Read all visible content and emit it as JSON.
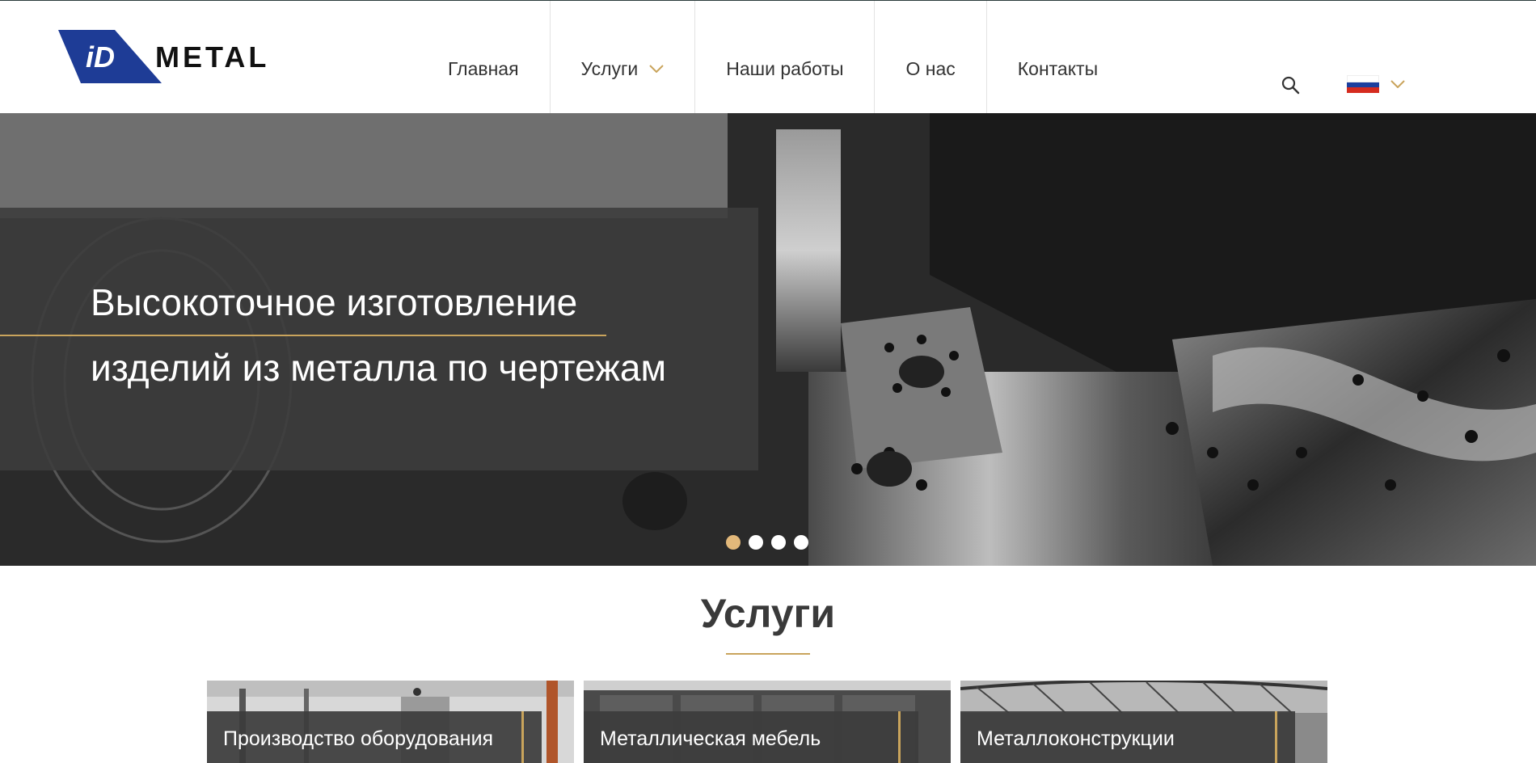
{
  "header": {
    "logo_text": "iDMETAL",
    "nav": [
      {
        "label": "Главная"
      },
      {
        "label": "Услуги",
        "has_dropdown": true
      },
      {
        "label": "Наши работы"
      },
      {
        "label": "О нас"
      },
      {
        "label": "Контакты"
      }
    ],
    "language": "ru",
    "icons": {
      "search": "search-icon",
      "chevron": "chevron-down-icon",
      "flag": "flag-russia-icon"
    }
  },
  "hero": {
    "line1": "Высокоточное изготовление",
    "line2": "изделий из металла по чертежам",
    "slides": 4,
    "active_slide": 1
  },
  "services": {
    "title": "Услуги",
    "cards": [
      {
        "label": "Производство оборудования"
      },
      {
        "label": "Металлическая мебель"
      },
      {
        "label": "Металлоконструкции"
      }
    ]
  },
  "colors": {
    "accent": "#c9a45c",
    "logo_blue": "#1e3c96",
    "overlay": "#3c3c3c",
    "active_dot": "#e2b87a"
  }
}
